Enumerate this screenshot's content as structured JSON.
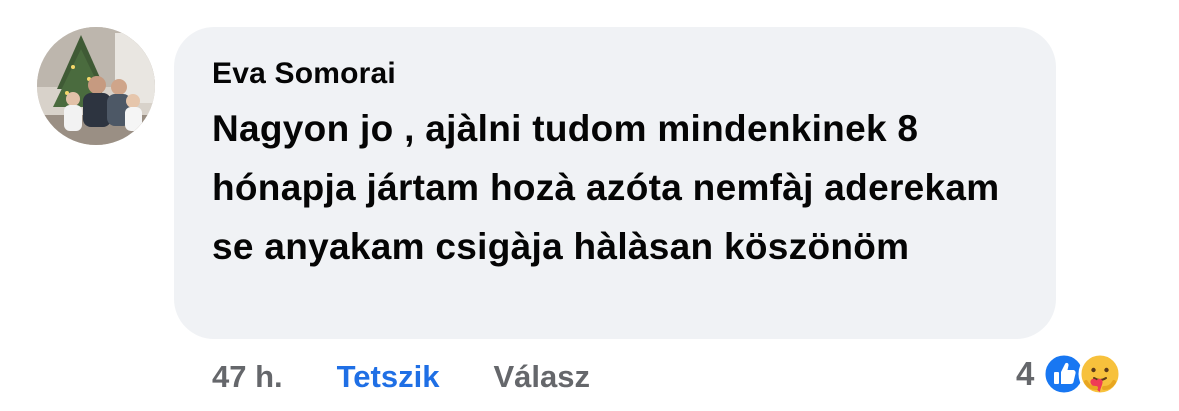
{
  "comment": {
    "author": "Eva Somorai",
    "text": "Nagyon jo , ajàlni tudom mindenkinek 8 hónapja jártam hozà azóta nemfàj aderekam se anyakam csigàja hàlàsan köszönöm",
    "avatar": "avatar-photo"
  },
  "actions": {
    "timestamp": "47 h.",
    "like_label": "Tetszik",
    "reply_label": "Válasz"
  },
  "reactions": {
    "count": "4",
    "icons": [
      "like-icon",
      "care-icon"
    ]
  },
  "colors": {
    "bubble": "#f0f2f5",
    "text": "#050505",
    "muted": "#65676b",
    "like_blue": "#1f6fe5",
    "care_yellow": "#f7c13c"
  }
}
